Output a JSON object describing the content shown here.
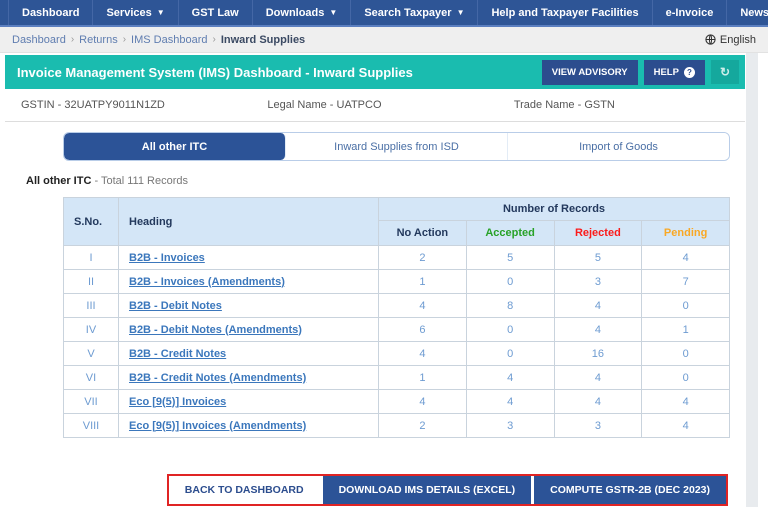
{
  "nav": {
    "items": [
      {
        "label": "Dashboard",
        "dropdown": false
      },
      {
        "label": "Services",
        "dropdown": true
      },
      {
        "label": "GST Law",
        "dropdown": false
      },
      {
        "label": "Downloads",
        "dropdown": true
      },
      {
        "label": "Search Taxpayer",
        "dropdown": true
      },
      {
        "label": "Help and Taxpayer Facilities",
        "dropdown": false
      },
      {
        "label": "e-Invoice",
        "dropdown": false
      },
      {
        "label": "News and Updates",
        "dropdown": false
      }
    ]
  },
  "breadcrumb": {
    "links": [
      "Dashboard",
      "Returns",
      "IMS Dashboard"
    ],
    "current": "Inward Supplies",
    "language": "English"
  },
  "header": {
    "title": "Invoice Management System (IMS) Dashboard - Inward Supplies",
    "view_advisory_label": "VIEW ADVISORY",
    "help_label": "HELP",
    "help_badge": "?",
    "refresh_icon": "↻"
  },
  "taxpayer": {
    "gstin": "GSTIN - 32UATPY9011N1ZD",
    "legal_name": "Legal Name - UATPCO",
    "trade_name": "Trade Name - GSTN"
  },
  "tabs": [
    {
      "label": "All other ITC",
      "active": true
    },
    {
      "label": "Inward Supplies from ISD",
      "active": false
    },
    {
      "label": "Import of Goods",
      "active": false
    }
  ],
  "summary": {
    "title": "All other ITC",
    "subtitle": " - Total 111 Records"
  },
  "table": {
    "col_sno": "S.No.",
    "col_heading": "Heading",
    "col_group": "Number of Records",
    "col_no_action": "No Action",
    "col_accepted": "Accepted",
    "col_rejected": "Rejected",
    "col_pending": "Pending",
    "rows": [
      {
        "sno": "I",
        "heading": "B2B - Invoices",
        "no_action": 2,
        "accepted": 5,
        "rejected": 5,
        "pending": 4
      },
      {
        "sno": "II",
        "heading": "B2B - Invoices (Amendments)",
        "no_action": 1,
        "accepted": 0,
        "rejected": 3,
        "pending": 7
      },
      {
        "sno": "III",
        "heading": "B2B - Debit Notes",
        "no_action": 4,
        "accepted": 8,
        "rejected": 4,
        "pending": 0
      },
      {
        "sno": "IV",
        "heading": "B2B - Debit Notes (Amendments)",
        "no_action": 6,
        "accepted": 0,
        "rejected": 4,
        "pending": 1
      },
      {
        "sno": "V",
        "heading": "B2B - Credit Notes",
        "no_action": 4,
        "accepted": 0,
        "rejected": 16,
        "pending": 0
      },
      {
        "sno": "VI",
        "heading": "B2B - Credit Notes (Amendments)",
        "no_action": 1,
        "accepted": 4,
        "rejected": 4,
        "pending": 0
      },
      {
        "sno": "VII",
        "heading": "Eco [9(5)] Invoices",
        "no_action": 4,
        "accepted": 4,
        "rejected": 4,
        "pending": 4
      },
      {
        "sno": "VIII",
        "heading": "Eco [9(5)] Invoices (Amendments)",
        "no_action": 2,
        "accepted": 3,
        "rejected": 3,
        "pending": 4
      }
    ]
  },
  "footer": {
    "buttons": [
      {
        "label": "BACK TO DASHBOARD",
        "style": "light"
      },
      {
        "label": "DOWNLOAD IMS DETAILS (EXCEL)",
        "style": "dark"
      },
      {
        "label": "COMPUTE GSTR-2B (DEC 2023)",
        "style": "dark"
      }
    ]
  },
  "colors": {
    "nav_blue": "#2e5596",
    "teal": "#1abcaf",
    "button_navy": "#2c5397",
    "accepted_green": "#28a228",
    "rejected_red": "#fb1b1b",
    "pending_orange": "#f9a825",
    "link_blue": "#3b77bc",
    "value_blue": "#6d9bd1",
    "highlight_red": "#e02424"
  }
}
